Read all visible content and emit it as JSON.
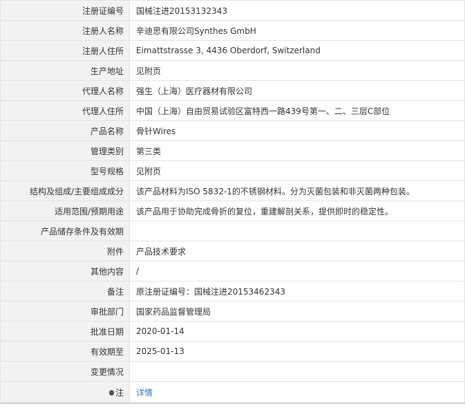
{
  "rows": [
    {
      "label": "注册证编号",
      "value": "国械注进20153132343"
    },
    {
      "label": "注册人名称",
      "value": "辛迪思有限公司Synthes GmbH"
    },
    {
      "label": "注册人住所",
      "value": "Eimattstrasse 3, 4436 Oberdorf, Switzerland"
    },
    {
      "label": "生产地址",
      "value": "见附页"
    },
    {
      "label": "代理人名称",
      "value": "强生（上海）医疗器材有限公司"
    },
    {
      "label": "代理人住所",
      "value": "中国（上海）自由贸易试验区富特西一路439号第一、二、三层C部位"
    },
    {
      "label": "产品名称",
      "value": "骨针Wires"
    },
    {
      "label": "管理类别",
      "value": "第三类"
    },
    {
      "label": "型号规格",
      "value": "见附页"
    },
    {
      "label": "结构及组成/主要组成成分",
      "value": "该产品材料为ISO 5832-1的不锈钢材料。分为灭菌包装和非灭菌两种包装。"
    },
    {
      "label": "适用范围/预期用途",
      "value": "该产品用于协助完成骨折的复位，重建解剖关系，提供即时的稳定性。"
    },
    {
      "label": "产品储存条件及有效期",
      "value": ""
    },
    {
      "label": "附件",
      "value": "产品技术要求"
    },
    {
      "label": "其他内容",
      "value": "/"
    },
    {
      "label": "备注",
      "value": "原注册证编号：国械注进20153462343"
    },
    {
      "label": "审批部门",
      "value": "国家药品监督管理局"
    },
    {
      "label": "批准日期",
      "value": "2020-01-14"
    },
    {
      "label": "有效期至",
      "value": "2025-01-13"
    },
    {
      "label": "变更情况",
      "value": ""
    }
  ],
  "note": {
    "label": "注",
    "icon": "lightbulb-icon",
    "link_text": "详情",
    "link_color": "#2d78c8"
  }
}
